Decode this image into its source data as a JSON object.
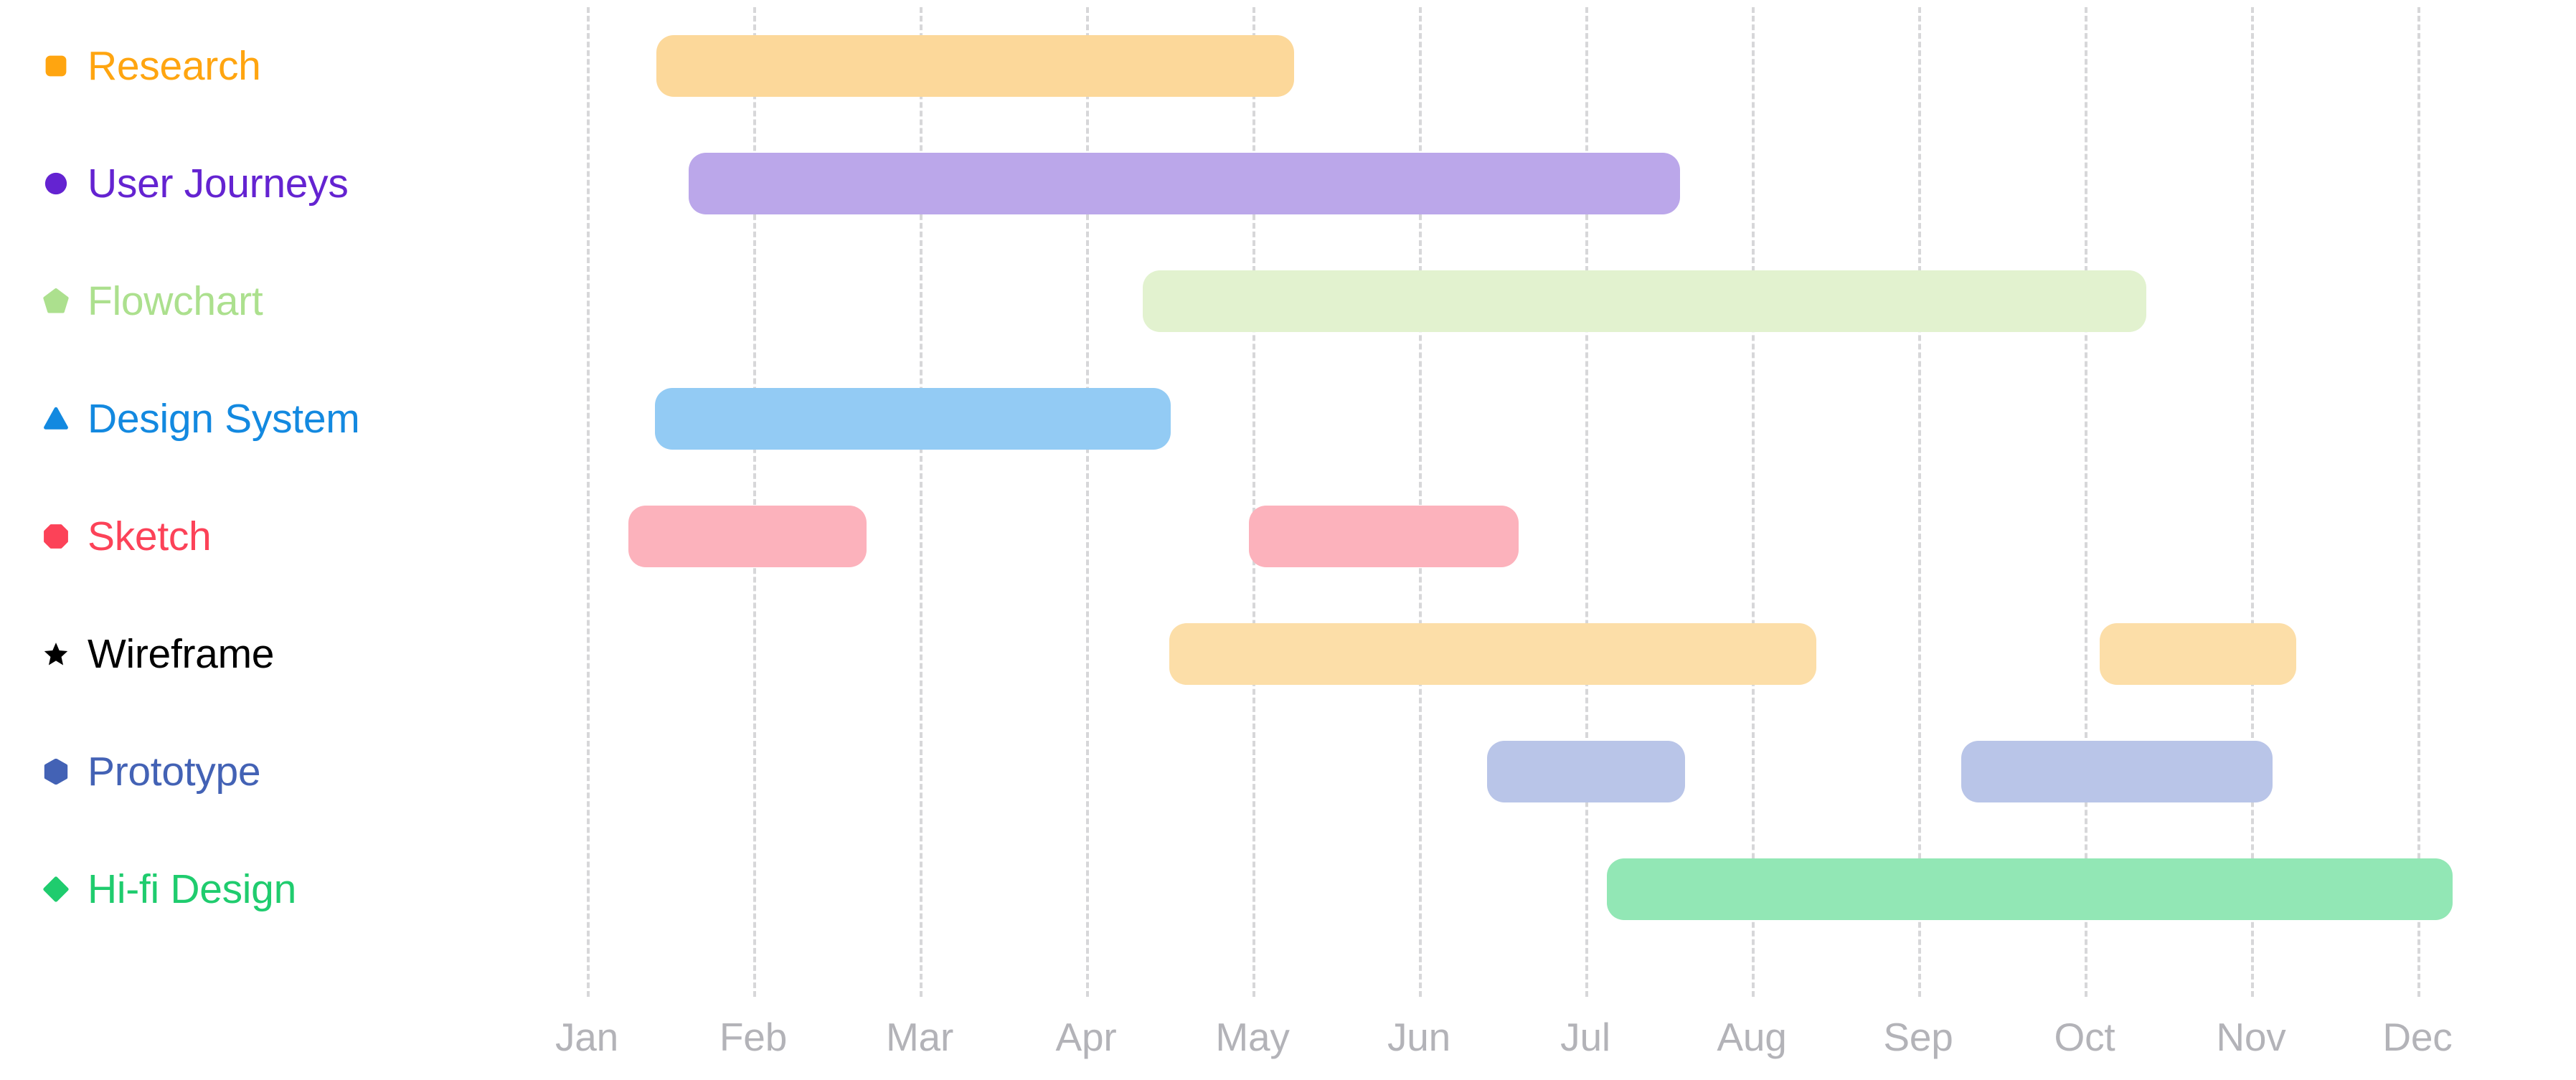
{
  "chart_data": {
    "type": "bar",
    "chart_kind": "gantt",
    "title": "",
    "xlabel": "",
    "ylabel": "",
    "grid": true,
    "legend_position": "left-axis",
    "x_axis": {
      "tick_labels": [
        "Jan",
        "Feb",
        "Mar",
        "Apr",
        "May",
        "Jun",
        "Jul",
        "Aug",
        "Sep",
        "Oct",
        "Nov",
        "Dec"
      ],
      "xlim": [
        0,
        12
      ],
      "unit": "month"
    },
    "categories": [
      "Research",
      "User Journeys",
      "Flowchart",
      "Design System",
      "Sketch",
      "Wireframe",
      "Prototype",
      "Hi-fi Design"
    ],
    "series": [
      {
        "name": "Research",
        "marker": "rounded-square-marker",
        "label_color": "#FFA510",
        "bar_color": "#FCD89A",
        "segments": [
          {
            "start": 0.42,
            "end": 4.25
          }
        ]
      },
      {
        "name": "User Journeys",
        "marker": "circle-marker",
        "label_color": "#6423D1",
        "bar_color": "#BBA7EA",
        "segments": [
          {
            "start": 0.61,
            "end": 6.57
          }
        ]
      },
      {
        "name": "Flowchart",
        "marker": "pentagon-marker",
        "label_color": "#ACE08E",
        "bar_color": "#E2F2CF",
        "segments": [
          {
            "start": 3.34,
            "end": 9.37
          }
        ]
      },
      {
        "name": "Design System",
        "marker": "triangle-marker",
        "label_color": "#1389E0",
        "bar_color": "#93CBF4",
        "segments": [
          {
            "start": 0.41,
            "end": 3.51
          }
        ]
      },
      {
        "name": "Sketch",
        "marker": "octagon-marker",
        "label_color": "#FC4258",
        "bar_color": "#FCB2BC",
        "segments": [
          {
            "start": 0.25,
            "end": 1.68
          },
          {
            "start": 3.98,
            "end": 5.6
          }
        ]
      },
      {
        "name": "Wireframe",
        "marker": "star-marker",
        "label_color": "#FCC košenia",
        "bar_color": "#FCDEA8",
        "segments": [
          {
            "start": 3.5,
            "end": 7.39
          },
          {
            "start": 9.09,
            "end": 10.27
          }
        ]
      },
      {
        "name": "Prototype",
        "marker": "hexagon-marker",
        "label_color": "#4362B5",
        "bar_color": "#B9C5E8",
        "segments": [
          {
            "start": 5.41,
            "end": 6.6
          },
          {
            "start": 8.26,
            "end": 10.13
          }
        ]
      },
      {
        "name": "Hi-fi Design",
        "marker": "diamond-marker",
        "label_color": "#1FCC6E",
        "bar_color": "#92E7B5",
        "segments": [
          {
            "start": 6.13,
            "end": 11.21
          }
        ]
      }
    ]
  },
  "palette": {
    "background": "#ffffff",
    "gridline": "#d7d7d9",
    "axis_text": "#b3b3b8"
  }
}
